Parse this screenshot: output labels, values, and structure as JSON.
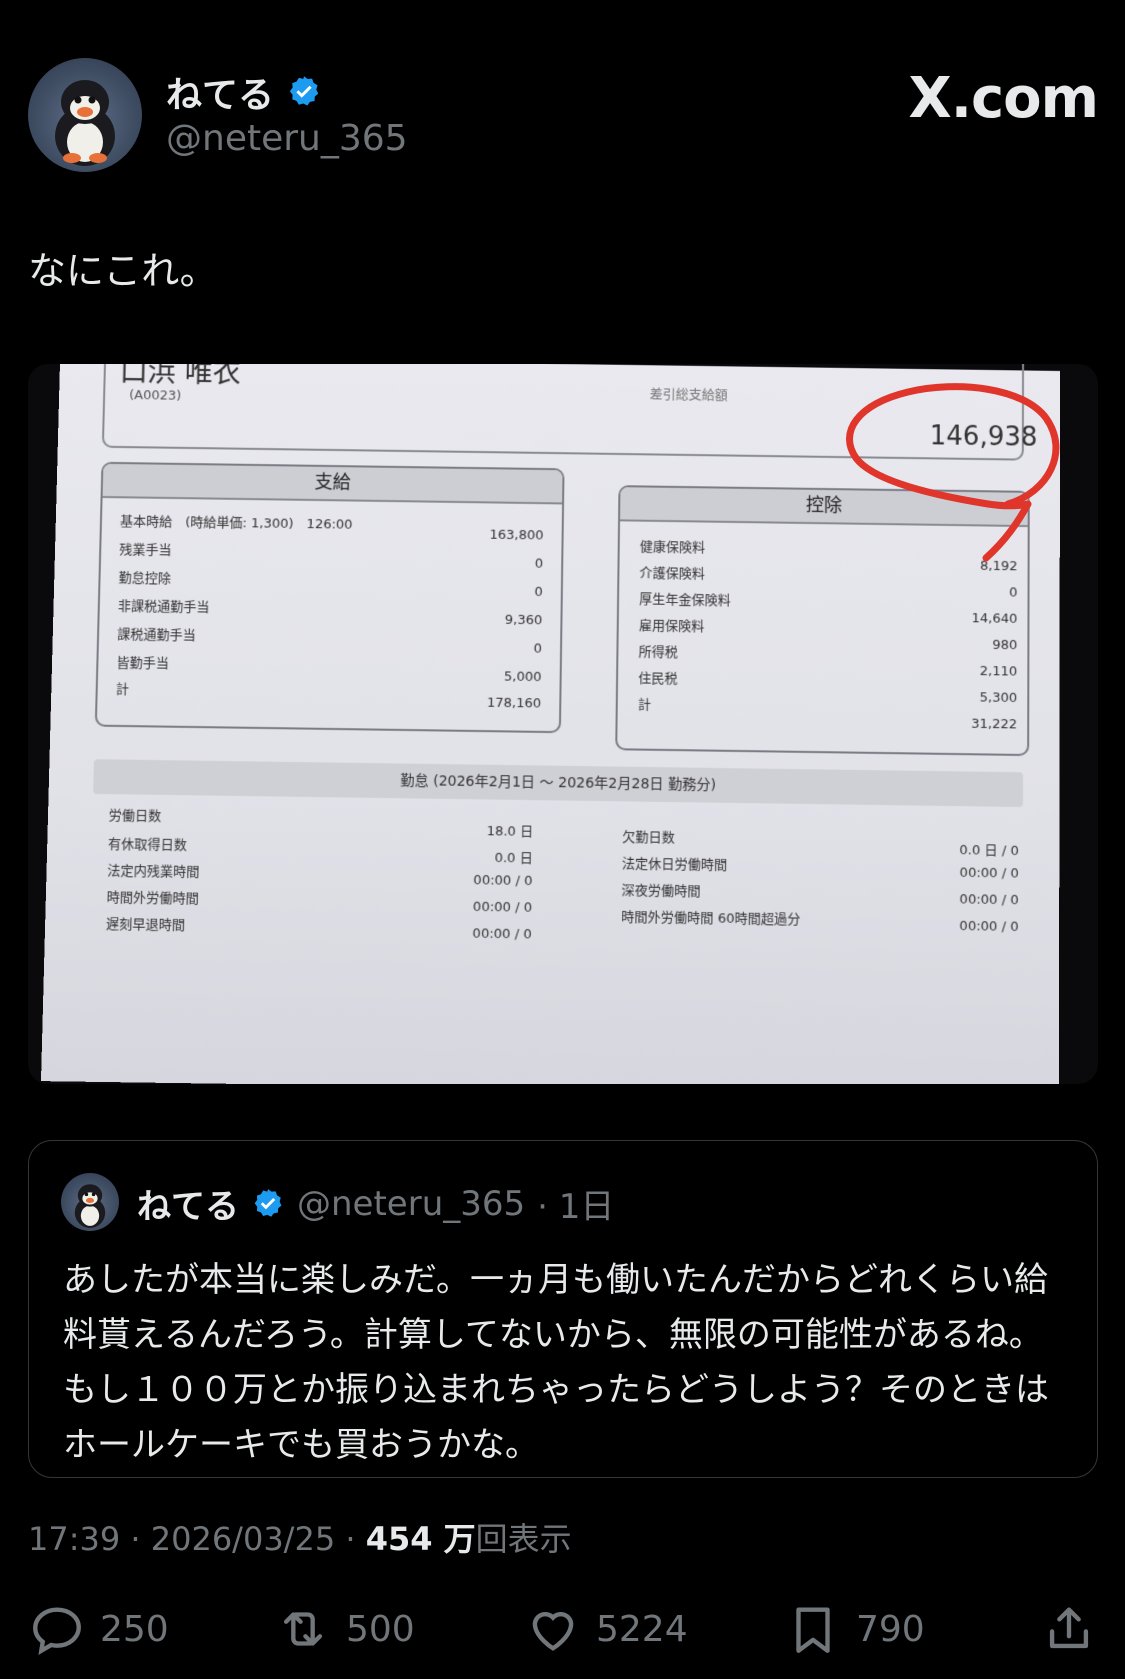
{
  "author": {
    "name": "ねてる",
    "handle": "@neteru_365"
  },
  "brand": "X.com",
  "tweet": {
    "text": "なにこれ。"
  },
  "payslip": {
    "name_partial": "口浜 唯衣",
    "employee_code": "(A0023)",
    "net_label": "差引総支給額",
    "net_amount": "146,938",
    "pay_section": {
      "title": "支給",
      "rows": [
        {
          "label": "基本時給　(時給単価: 1,300)　126:00",
          "value": "163,800"
        },
        {
          "label": "残業手当",
          "value": "0"
        },
        {
          "label": "勤怠控除",
          "value": "0"
        },
        {
          "label": "非課税通勤手当",
          "value": "9,360"
        },
        {
          "label": "課税通勤手当",
          "value": "0"
        },
        {
          "label": "皆勤手当",
          "value": "5,000"
        },
        {
          "label": "計",
          "value": "178,160"
        }
      ]
    },
    "deduction_section": {
      "title": "控除",
      "rows": [
        {
          "label": "健康保険料",
          "value": "8,192"
        },
        {
          "label": "介護保険料",
          "value": "0"
        },
        {
          "label": "厚生年金保険料",
          "value": "14,640"
        },
        {
          "label": "雇用保険料",
          "value": "980"
        },
        {
          "label": "所得税",
          "value": "2,110"
        },
        {
          "label": "住民税",
          "value": "5,300"
        },
        {
          "label": "計",
          "value": "31,222"
        }
      ]
    },
    "attendance": {
      "title": "勤怠 (2026年2月1日 〜 2026年2月28日 勤務分)",
      "left": [
        {
          "label": "労働日数",
          "value": "18.0 日"
        },
        {
          "label": "有休取得日数",
          "value": "0.0 日"
        },
        {
          "label": "法定内残業時間",
          "value": "00:00 / 0"
        },
        {
          "label": "時間外労働時間",
          "value": "00:00 / 0"
        },
        {
          "label": "遅刻早退時間",
          "value": "00:00 / 0"
        }
      ],
      "right": [
        {
          "label": "欠勤日数",
          "value": "0.0 日 / 0"
        },
        {
          "label": "法定休日労働時間",
          "value": "00:00 / 0"
        },
        {
          "label": "深夜労働時間",
          "value": "00:00 / 0"
        },
        {
          "label": "時間外労働時間 60時間超過分",
          "value": "00:00 / 0"
        }
      ]
    },
    "annotation_color": "#e0352b"
  },
  "quoted": {
    "name": "ねてる",
    "handle": "@neteru_365",
    "time": "· 1日",
    "text": "あしたが本当に楽しみだ。一ヵ月も働いたんだからどれくらい給料貰えるんだろう。計算してないから、無限の可能性があるね。もし１００万とか振り込まれちゃったらどうしよう？そのときはホールケーキでも買おうかな。"
  },
  "meta": {
    "timestamp": "17:39 · 2026/03/25 · ",
    "views_number": "454 万",
    "views_label": "回表示"
  },
  "actions": {
    "replies": "250",
    "reposts": "500",
    "likes": "5224",
    "bookmarks": "790"
  },
  "colors": {
    "background": "#000000",
    "text": "#e7e9ea",
    "muted": "#71767b",
    "verified": "#1d9bf0",
    "border": "#333639"
  }
}
